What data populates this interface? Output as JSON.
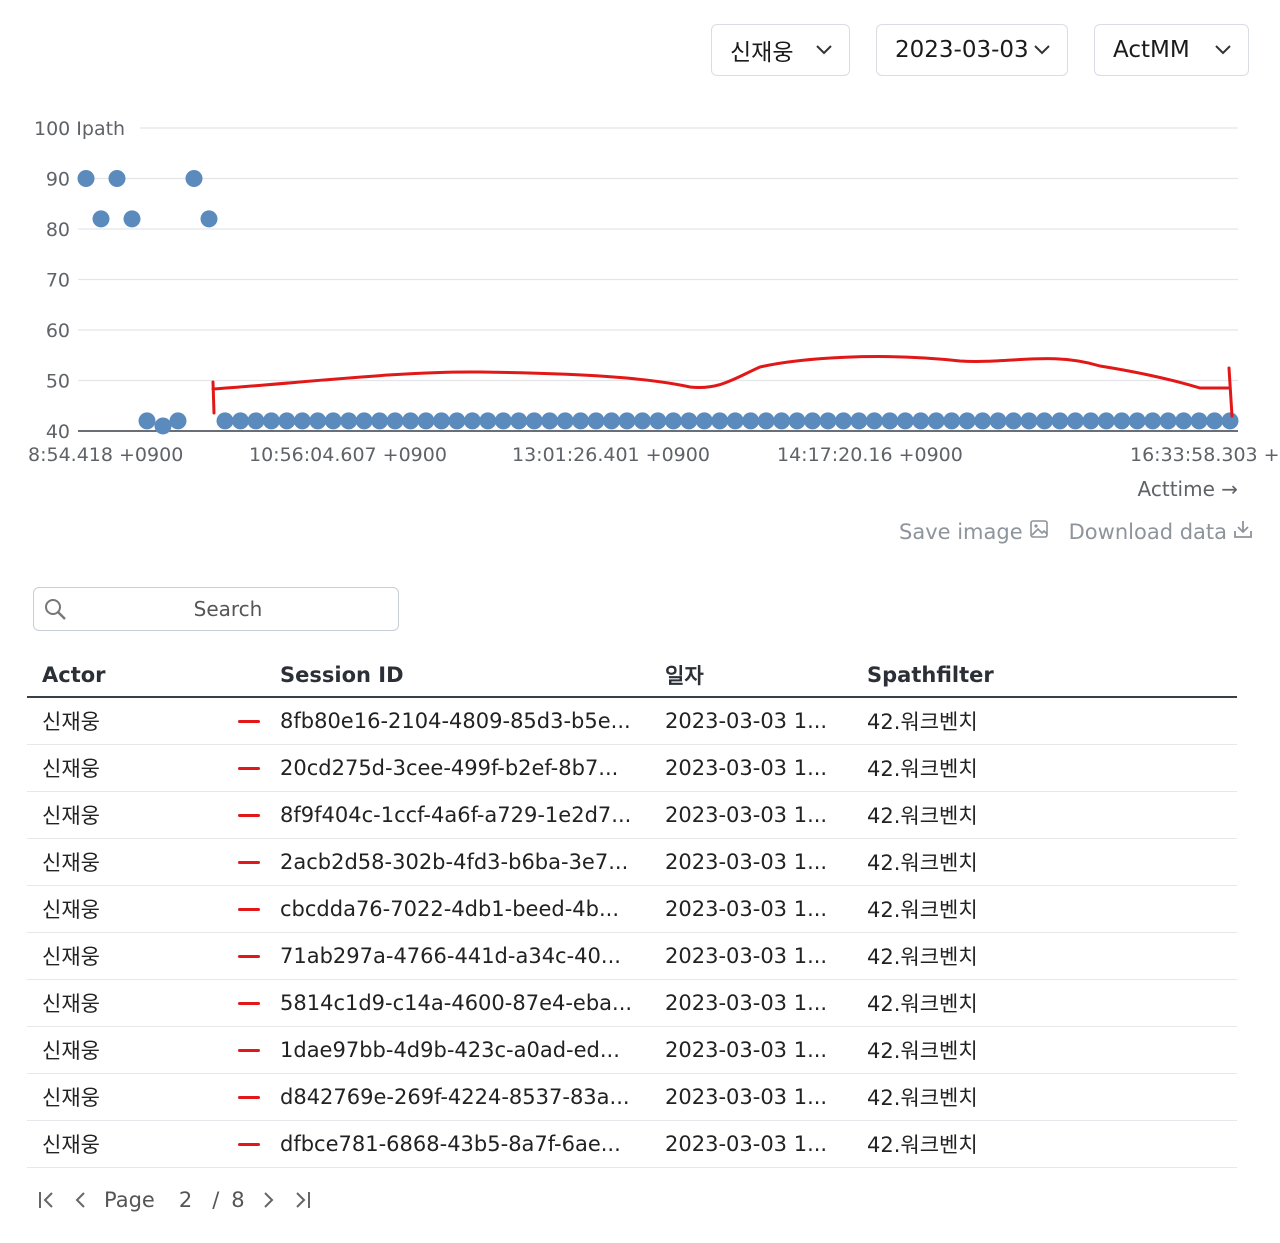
{
  "filters": {
    "user": "신재웅",
    "date": "2023-03-03",
    "metric": "ActMM"
  },
  "chart_data": {
    "type": "scatter",
    "ylabel": "Ipath",
    "xlabel": "Acttime →",
    "ylim": [
      40,
      100
    ],
    "yticks": [
      "40",
      "50",
      "60",
      "70",
      "80",
      "90",
      "100"
    ],
    "xticks": [
      "8:54.418 +0900",
      "10:56:04.607 +0900",
      "13:01:26.401 +0900",
      "14:17:20.16 +0900",
      "16:33:58.303 +"
    ],
    "point_color": "#5b8bbd",
    "annotation_color": "#e21818",
    "series": [
      {
        "points_index": [
          0,
          1,
          2,
          3,
          4,
          5,
          6,
          7,
          8,
          9
        ],
        "values": [
          90,
          82,
          90,
          82,
          42,
          41,
          42,
          90,
          82,
          42
        ]
      }
    ],
    "baseline_count": 66,
    "baseline_value": 42
  },
  "actions": {
    "save_image": "Save image",
    "download_data": "Download data"
  },
  "search": {
    "placeholder": "Search"
  },
  "table": {
    "headers": [
      "Actor",
      "Session ID",
      "일자",
      "Spathfilter"
    ],
    "rows": [
      [
        "신재웅",
        "8fb80e16-2104-4809-85d3-b5e...",
        "2023-03-03 1...",
        "42.워크벤치"
      ],
      [
        "신재웅",
        "20cd275d-3cee-499f-b2ef-8b7...",
        "2023-03-03 1...",
        "42.워크벤치"
      ],
      [
        "신재웅",
        "8f9f404c-1ccf-4a6f-a729-1e2d7...",
        "2023-03-03 1...",
        "42.워크벤치"
      ],
      [
        "신재웅",
        "2acb2d58-302b-4fd3-b6ba-3e7...",
        "2023-03-03 1...",
        "42.워크벤치"
      ],
      [
        "신재웅",
        "cbcdda76-7022-4db1-beed-4b...",
        "2023-03-03 1...",
        "42.워크벤치"
      ],
      [
        "신재웅",
        "71ab297a-4766-441d-a34c-40...",
        "2023-03-03 1...",
        "42.워크벤치"
      ],
      [
        "신재웅",
        "5814c1d9-c14a-4600-87e4-eba...",
        "2023-03-03 1...",
        "42.워크벤치"
      ],
      [
        "신재웅",
        "1dae97bb-4d9b-423c-a0ad-ed...",
        "2023-03-03 1...",
        "42.워크벤치"
      ],
      [
        "신재웅",
        "d842769e-269f-4224-8537-83a...",
        "2023-03-03 1...",
        "42.워크벤치"
      ],
      [
        "신재웅",
        "dfbce781-6868-43b5-8a7f-6ae...",
        "2023-03-03 1...",
        "42.워크벤치"
      ]
    ]
  },
  "pager": {
    "label": "Page",
    "current": "2",
    "sep": "/",
    "total": "8"
  }
}
